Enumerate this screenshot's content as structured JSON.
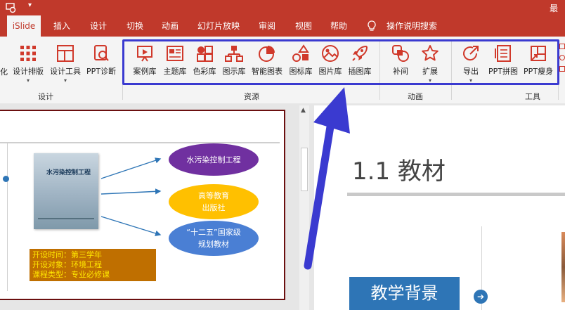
{
  "titlebar": {
    "right_text": "最终"
  },
  "tabs": [
    "iSlide",
    "插入",
    "设计",
    "切换",
    "动画",
    "幻灯片放映",
    "审阅",
    "视图",
    "帮助",
    "操作说明搜索"
  ],
  "ribbon": {
    "left_cut_label": "化",
    "design_group": {
      "label": "设计",
      "buttons": [
        "设计排版",
        "设计工具",
        "PPT诊断"
      ]
    },
    "resource_group": {
      "label": "资源",
      "buttons": [
        "案例库",
        "主题库",
        "色彩库",
        "图示库",
        "智能图表",
        "图标库",
        "图片库",
        "插图库"
      ]
    },
    "animation_group": {
      "label": "动画",
      "buttons": [
        "补间",
        "扩展"
      ]
    },
    "tools_group": {
      "label": "工具",
      "buttons": [
        "导出",
        "PPT拼图",
        "PPT瘦身"
      ]
    }
  },
  "slide_left": {
    "book_title": "水污染控制工程",
    "ovals": [
      "水污染控制工程",
      "高等教育\n出版社",
      "“十二五”国家级\n规划教材"
    ],
    "info_lines": [
      "开设时间：第三学年",
      "开设对象：环境工程",
      "课程类型：专业必修课"
    ]
  },
  "slide_right": {
    "heading": "1.1 教材",
    "banner": "教学背景"
  },
  "colors": {
    "brand_red": "#c0392b",
    "highlight_blue": "#3a3ad0",
    "oval_purple": "#7030a0",
    "oval_yellow": "#ffc000",
    "oval_blue": "#4a7fd4",
    "info_brown": "#bf6f00",
    "banner_blue": "#2e75b6"
  }
}
